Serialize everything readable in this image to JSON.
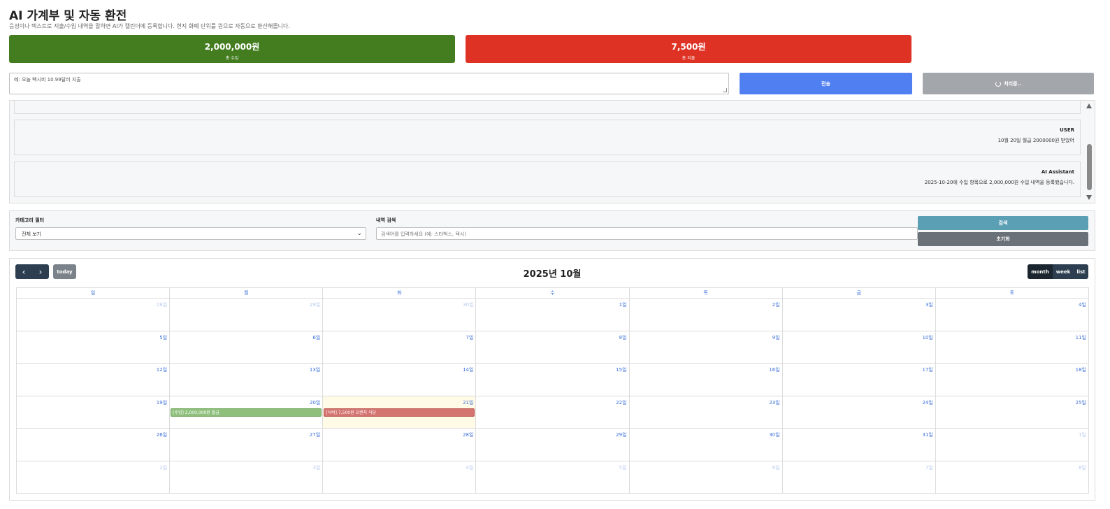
{
  "header": {
    "title": "AI 가계부 및 자동 환전",
    "subtitle": "음성이나 텍스트로 지출/수입 내역을 말하면 AI가 캘린더에 등록합니다. 현지 화폐 단위를 원으로 자동으로 환산해줍니다."
  },
  "stats": {
    "income_amount": "2,000,000원",
    "income_label": "총 수입",
    "expense_amount": "7,500원",
    "expense_label": "총 지출"
  },
  "input": {
    "placeholder": "예: 오늘 택시비 10.99달러 지출",
    "send_label": "전송",
    "processing_label": "처리중.."
  },
  "chat": {
    "messages": [
      {
        "role": "USER",
        "text": "10월 20일 월급 2000000원 받았어"
      },
      {
        "role": "AI Assistant",
        "text": "2025-10-20에 수입 항목으로 2,000,000원 수입 내역을 등록했습니다."
      }
    ]
  },
  "filters": {
    "category_label": "카테고리 필터",
    "category_value": "전체 보기",
    "search_label": "내역 검색",
    "search_placeholder": "검색어를 입력하세요 (예: 스타벅스, 택시)",
    "search_button": "검색",
    "reset_button": "초기화"
  },
  "calendar": {
    "title": "2025년 10월",
    "today_label": "today",
    "prev_icon": "‹",
    "next_icon": "›",
    "views": {
      "month": "month",
      "week": "week",
      "list": "list"
    },
    "weekdays": [
      "일",
      "월",
      "화",
      "수",
      "목",
      "금",
      "토"
    ],
    "weeks": [
      [
        {
          "d": "28일",
          "o": true
        },
        {
          "d": "29일",
          "o": true
        },
        {
          "d": "30일",
          "o": true
        },
        {
          "d": "1일"
        },
        {
          "d": "2일"
        },
        {
          "d": "3일"
        },
        {
          "d": "4일"
        }
      ],
      [
        {
          "d": "5일"
        },
        {
          "d": "6일"
        },
        {
          "d": "7일"
        },
        {
          "d": "8일"
        },
        {
          "d": "9일"
        },
        {
          "d": "10일"
        },
        {
          "d": "11일"
        }
      ],
      [
        {
          "d": "12일"
        },
        {
          "d": "13일"
        },
        {
          "d": "14일"
        },
        {
          "d": "15일"
        },
        {
          "d": "16일"
        },
        {
          "d": "17일"
        },
        {
          "d": "18일"
        }
      ],
      [
        {
          "d": "19일"
        },
        {
          "d": "20일",
          "event": {
            "type": "income",
            "text": "[수입] 2,000,000원 월급"
          }
        },
        {
          "d": "21일",
          "today": true,
          "event": {
            "type": "expense",
            "text": "[식비] 7,500원 오렌지 식당"
          }
        },
        {
          "d": "22일"
        },
        {
          "d": "23일"
        },
        {
          "d": "24일"
        },
        {
          "d": "25일"
        }
      ],
      [
        {
          "d": "26일"
        },
        {
          "d": "27일"
        },
        {
          "d": "28일"
        },
        {
          "d": "29일"
        },
        {
          "d": "30일"
        },
        {
          "d": "31일"
        },
        {
          "d": "1일",
          "o": true
        }
      ],
      [
        {
          "d": "2일",
          "o": true
        },
        {
          "d": "3일",
          "o": true
        },
        {
          "d": "4일",
          "o": true
        },
        {
          "d": "5일",
          "o": true
        },
        {
          "d": "6일",
          "o": true
        },
        {
          "d": "7일",
          "o": true
        },
        {
          "d": "8일",
          "o": true
        }
      ]
    ]
  },
  "colors": {
    "income": "#437d1f",
    "expense": "#de3224",
    "send": "#507ff2",
    "calendar_nav": "#2c3e50"
  }
}
